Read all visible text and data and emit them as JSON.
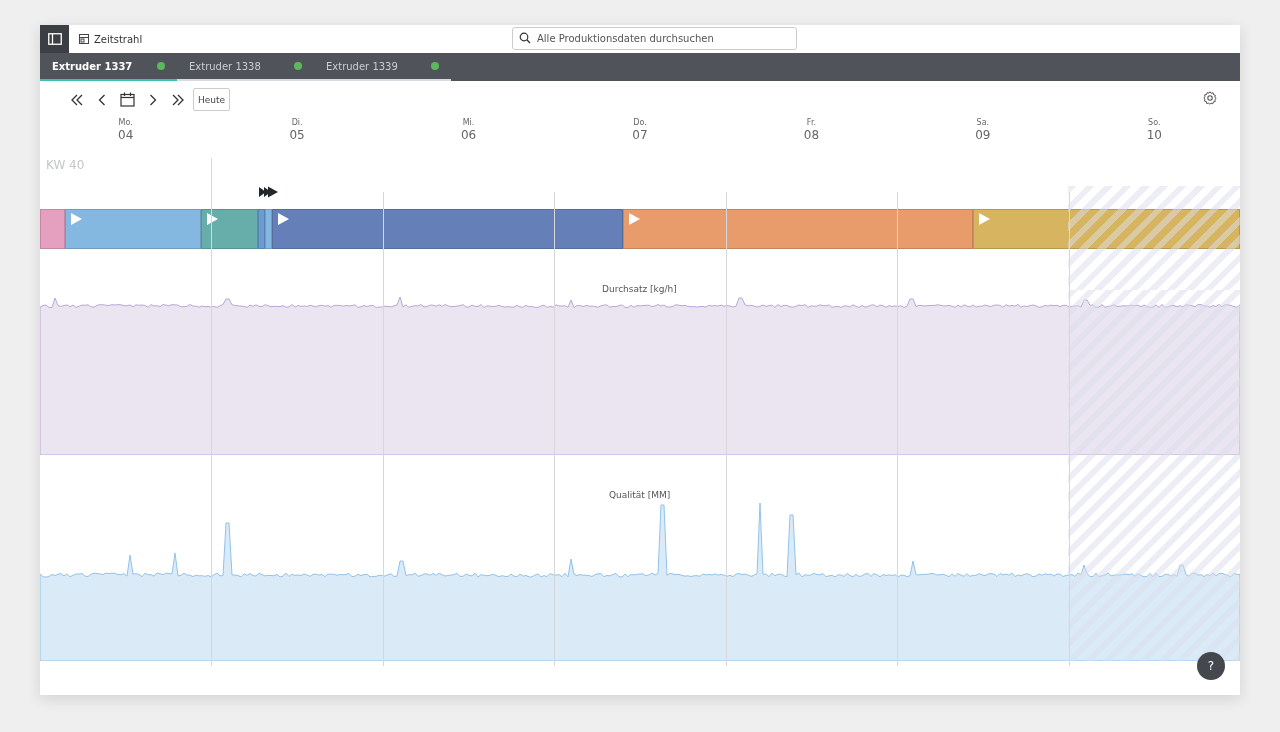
{
  "top_bar": {
    "view_label": "Zeitstrahl",
    "search": {
      "placeholder": "Alle Produktionsdaten durchsuchen"
    }
  },
  "tabs": [
    {
      "label": "Extruder 1337",
      "selected": true,
      "color": "#5cb85c"
    },
    {
      "label": "Extruder 1338",
      "selected": false,
      "color": "#5cb85c"
    },
    {
      "label": "Extruder 1339",
      "selected": false,
      "color": "#5cb85c"
    }
  ],
  "toolbar": {
    "today_button": "Heute"
  },
  "days": [
    {
      "weekday": "Mo.",
      "date": "04"
    },
    {
      "weekday": "Di.",
      "date": "05"
    },
    {
      "weekday": "Mi.",
      "date": "06"
    },
    {
      "weekday": "Do.",
      "date": "07"
    },
    {
      "weekday": "Fr.",
      "date": "08"
    },
    {
      "weekday": "Sa.",
      "date": "09"
    },
    {
      "weekday": "So.",
      "date": "10"
    }
  ],
  "week_label": "KW 40",
  "segments": [
    {
      "color": "#e5a0c0",
      "play": false
    },
    {
      "color": "#85b8e0",
      "play": true
    },
    {
      "color": "#67ada9",
      "play": true
    },
    {
      "color": "#6b9bd0",
      "play": false
    },
    {
      "color": "#85b8e0",
      "play": false
    },
    {
      "color": "#6580b8",
      "play": true
    },
    {
      "color": "#e89c6c",
      "play": true
    },
    {
      "color": "#d6b460",
      "play": true
    }
  ],
  "charts": [
    {
      "label": "Durchsatz [kg/h]"
    },
    {
      "label": "Qualität [MM]"
    }
  ],
  "help_button": "?"
}
